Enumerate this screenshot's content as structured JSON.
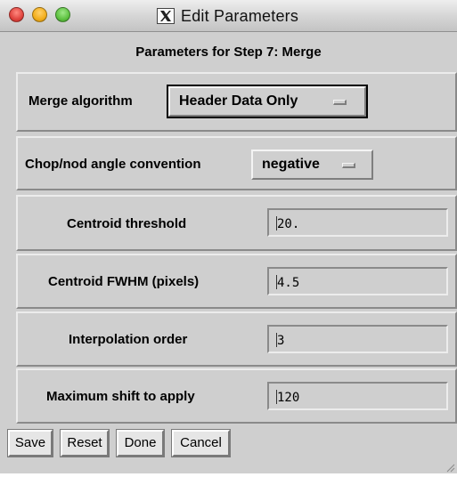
{
  "window": {
    "title": "Edit Parameters",
    "title_icon": "x11-logo-icon"
  },
  "heading": "Parameters for Step 7: Merge",
  "params": {
    "merge_algorithm": {
      "label": "Merge algorithm",
      "value": "Header Data Only"
    },
    "chop_nod_angle": {
      "label": "Chop/nod angle convention",
      "value": "negative"
    },
    "centroid_threshold": {
      "label": "Centroid threshold",
      "value": "20."
    },
    "centroid_fwhm": {
      "label": "Centroid FWHM (pixels)",
      "value": "4.5"
    },
    "interpolation_order": {
      "label": "Interpolation order",
      "value": "3"
    },
    "max_shift": {
      "label": "Maximum shift to apply",
      "value": "120"
    }
  },
  "buttons": {
    "save": "Save",
    "reset": "Reset",
    "done": "Done",
    "cancel": "Cancel"
  },
  "colors": {
    "background": "#cfcfcf",
    "close": "#e0443e",
    "minimize": "#f2ae1c",
    "zoom": "#5ec241"
  }
}
